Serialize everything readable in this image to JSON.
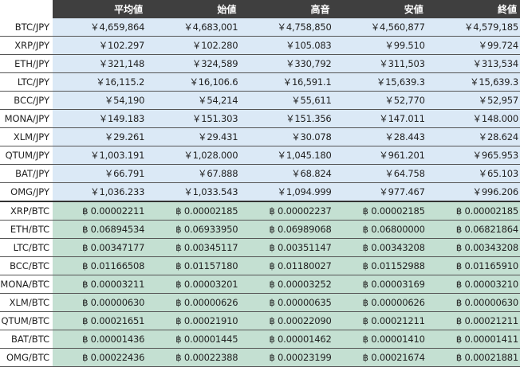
{
  "header": [
    "",
    "平均値",
    "始値",
    "高音",
    "安値",
    "終値"
  ],
  "jpy_rows": [
    [
      "BTC/JPY",
      "￥4,659,864",
      "￥4,683,001",
      "￥4,758,850",
      "￥4,560,877",
      "￥4,579,185"
    ],
    [
      "XRP/JPY",
      "￥102.297",
      "￥102.280",
      "￥105.083",
      "￥99.510",
      "￥99.724"
    ],
    [
      "ETH/JPY",
      "￥321,148",
      "￥324,589",
      "￥330,792",
      "￥311,503",
      "￥313,534"
    ],
    [
      "LTC/JPY",
      "￥16,115.2",
      "￥16,106.6",
      "￥16,591.1",
      "￥15,639.3",
      "￥15,639.3"
    ],
    [
      "BCC/JPY",
      "￥54,190",
      "￥54,214",
      "￥55,611",
      "￥52,770",
      "￥52,957"
    ],
    [
      "MONA/JPY",
      "￥149.183",
      "￥151.303",
      "￥151.356",
      "￥147.011",
      "￥148.000"
    ],
    [
      "XLM/JPY",
      "￥29.261",
      "￥29.431",
      "￥30.078",
      "￥28.443",
      "￥28.624"
    ],
    [
      "QTUM/JPY",
      "￥1,003.191",
      "￥1,028.000",
      "￥1,045.180",
      "￥961.201",
      "￥965.953"
    ],
    [
      "BAT/JPY",
      "￥66.791",
      "￥67.888",
      "￥68.824",
      "￥64.758",
      "￥65.103"
    ],
    [
      "OMG/JPY",
      "￥1,036.233",
      "￥1,033.543",
      "￥1,094.999",
      "￥977.467",
      "￥996.206"
    ]
  ],
  "btc_rows": [
    [
      "XRP/BTC",
      "฿ 0.00002211",
      "฿ 0.00002185",
      "฿ 0.00002237",
      "฿ 0.00002185",
      "฿ 0.00002185"
    ],
    [
      "ETH/BTC",
      "฿ 0.06894534",
      "฿ 0.06933950",
      "฿ 0.06989068",
      "฿ 0.06800000",
      "฿ 0.06821864"
    ],
    [
      "LTC/BTC",
      "฿ 0.00347177",
      "฿ 0.00345117",
      "฿ 0.00351147",
      "฿ 0.00343208",
      "฿ 0.00343208"
    ],
    [
      "BCC/BTC",
      "฿ 0.01166508",
      "฿ 0.01157180",
      "฿ 0.01180027",
      "฿ 0.01152988",
      "฿ 0.01165910"
    ],
    [
      "MONA/BTC",
      "฿ 0.00003211",
      "฿ 0.00003201",
      "฿ 0.00003252",
      "฿ 0.00003169",
      "฿ 0.00003210"
    ],
    [
      "XLM/BTC",
      "฿ 0.00000630",
      "฿ 0.00000626",
      "฿ 0.00000635",
      "฿ 0.00000626",
      "฿ 0.00000630"
    ],
    [
      "QTUM/BTC",
      "฿ 0.00021651",
      "฿ 0.00021910",
      "฿ 0.00022090",
      "฿ 0.00021211",
      "฿ 0.00021211"
    ],
    [
      "BAT/BTC",
      "฿ 0.00001436",
      "฿ 0.00001445",
      "฿ 0.00001462",
      "฿ 0.00001410",
      "฿ 0.00001411"
    ],
    [
      "OMG/BTC",
      "฿ 0.00022436",
      "฿ 0.00022388",
      "฿ 0.00023199",
      "฿ 0.00021674",
      "฿ 0.00021881"
    ]
  ],
  "colors": {
    "header_bg": "#3f3f3f",
    "jpy_row_bg": "#dbe9f6",
    "btc_row_bg": "#c4e0d2"
  }
}
